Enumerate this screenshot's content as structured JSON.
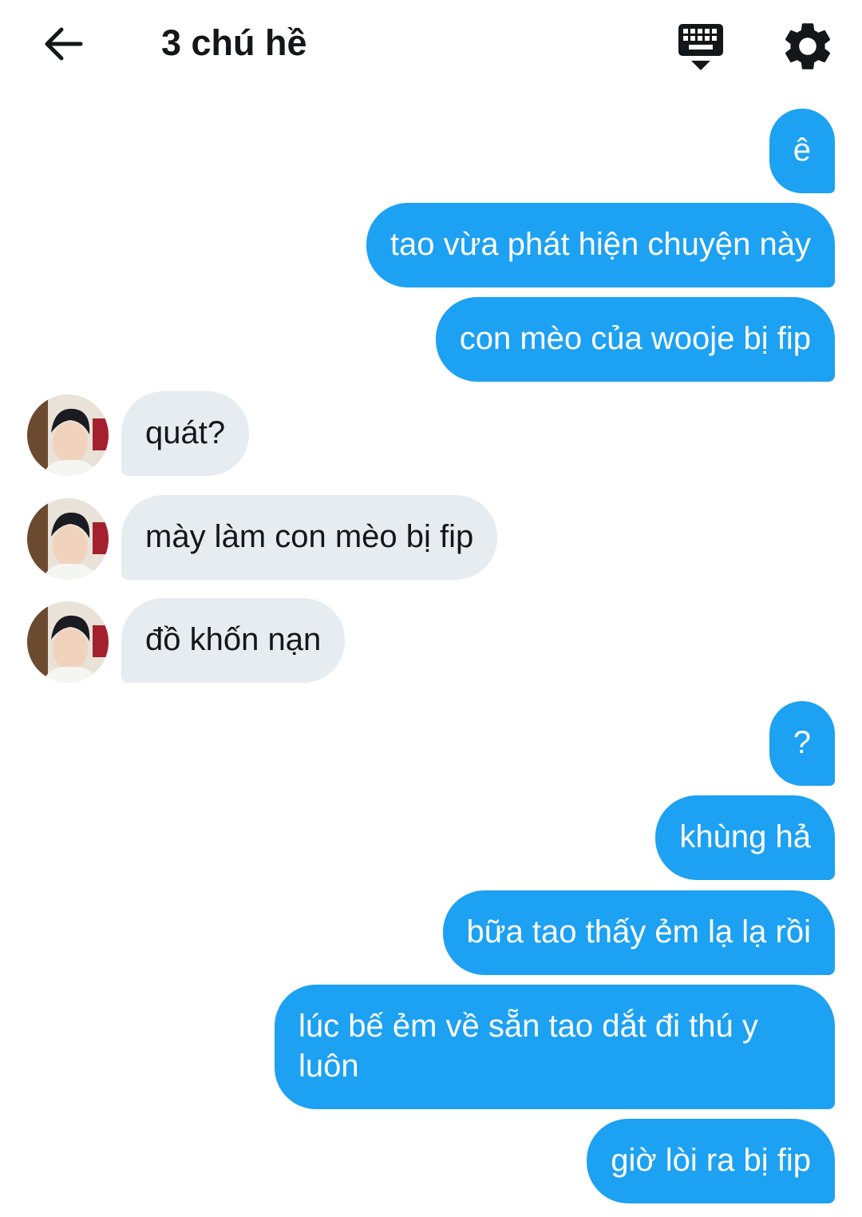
{
  "header": {
    "title": "3 chú hề",
    "icons": {
      "back": "arrow-left-icon",
      "keyboard": "keyboard-icon",
      "settings": "gear-icon"
    }
  },
  "messages": [
    {
      "side": "out",
      "text": "ê"
    },
    {
      "side": "out",
      "text": "tao vừa phát hiện chuyện này"
    },
    {
      "side": "out",
      "text": "con mèo của wooje bị fip"
    },
    {
      "side": "in",
      "text": "quát?"
    },
    {
      "side": "in",
      "text": "mày làm con mèo bị fip"
    },
    {
      "side": "in",
      "text": "đồ khốn nạn"
    },
    {
      "side": "out",
      "text": "?"
    },
    {
      "side": "out",
      "text": "khùng hả"
    },
    {
      "side": "out",
      "text": "bữa tao thấy ẻm lạ lạ rồi"
    },
    {
      "side": "out",
      "text": "lúc bế ẻm về sẵn tao dắt đi thú y luôn"
    },
    {
      "side": "out",
      "text": "giờ lòi ra bị fip"
    }
  ],
  "colors": {
    "outgoing_bubble": "#1da1f2",
    "incoming_bubble": "#e6ecf0",
    "text": "#14171a"
  }
}
